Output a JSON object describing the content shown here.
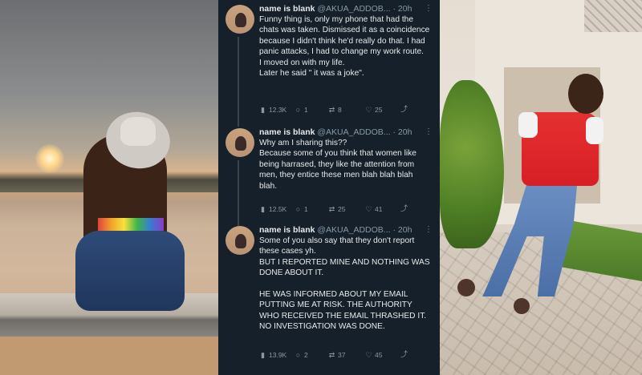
{
  "tweets": [
    {
      "name": "name is blank",
      "handle": "@AKUA_ADDOB...",
      "time": "20h",
      "text": "Funny thing is, only my phone that had the chats was taken. Dismissed it as a coincidence because I didn't think he'd really do that. I had panic attacks, I had to change my work route.\nI moved on with my life.\nLater he said \" it was a joke\".",
      "stats": {
        "views": "12.3K",
        "replies": "1",
        "retweets": "8",
        "likes": "25"
      }
    },
    {
      "name": "name is blank",
      "handle": "@AKUA_ADDOB...",
      "time": "20h",
      "text": "Why am I sharing this??\nBecause some of you think that women like being harrased, they like the attention from men, they entice these men blah blah blah blah.",
      "stats": {
        "views": "12.5K",
        "replies": "1",
        "retweets": "25",
        "likes": "41"
      }
    },
    {
      "name": "name is blank",
      "handle": "@AKUA_ADDOB...",
      "time": "20h",
      "text": "Some of you also say that they don't report these cases yh.\nBUT I REPORTED MINE AND NOTHING WAS DONE ABOUT IT.\n\nHE WAS INFORMED ABOUT MY EMAIL PUTTING ME AT RISK. THE AUTHORITY WHO RECEIVED THE EMAIL THRASHED IT. NO INVESTIGATION WAS DONE.",
      "stats": {
        "views": "13.9K",
        "replies": "2",
        "retweets": "37",
        "likes": "45"
      }
    }
  ],
  "icons": {
    "views": "bar-chart-icon",
    "reply": "comment-icon",
    "retweet": "retweet-icon",
    "like": "heart-icon",
    "share": "share-icon",
    "more": "more-icon"
  },
  "colors": {
    "panel_bg": "#15202b",
    "text": "#e7e9ea",
    "muted": "#8899a6"
  },
  "glyphs": {
    "dot": "·",
    "more": "⋮",
    "views": "▮",
    "reply": "○",
    "retweet": "⇄",
    "like": "♡",
    "share": "⤴"
  }
}
